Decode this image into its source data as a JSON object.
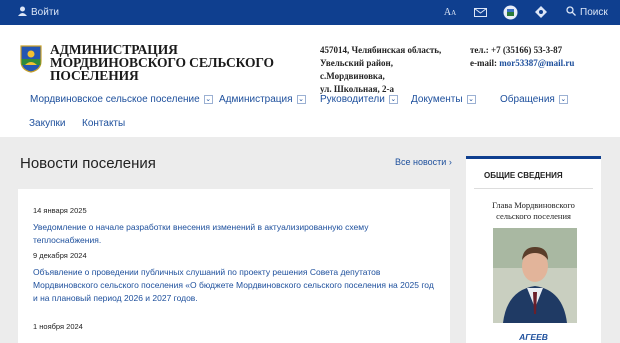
{
  "topbar": {
    "login_label": "Войти",
    "search_label": "Поиск",
    "icons": [
      "user-icon",
      "font-size-icon",
      "mail-icon",
      "emblem-icon",
      "accessibility-icon",
      "search-icon"
    ]
  },
  "header": {
    "org_title_lines": [
      "АДМИНИСТРАЦИЯ",
      "МОРДВИНОВСКОГО СЕЛЬСКОГО",
      "ПОСЕЛЕНИЯ"
    ],
    "address_lines": [
      "457014, Челябинская область,",
      "Увельский район,",
      "с.Мордвиновка,",
      "ул. Школьная, 2-а"
    ],
    "phone": "тел.: +7 (35166) 53-3-87",
    "email_label": "e-mail:",
    "email": "mor53387@mail.ru"
  },
  "nav": {
    "items": [
      {
        "label": "Мордвиновское сельское поселение",
        "has_dropdown": true
      },
      {
        "label": "Администрация",
        "has_dropdown": true
      },
      {
        "label": "Руководители",
        "has_dropdown": true
      },
      {
        "label": "Документы",
        "has_dropdown": true
      },
      {
        "label": "Обращения",
        "has_dropdown": true
      },
      {
        "label": "Закупки",
        "has_dropdown": false
      },
      {
        "label": "Контакты",
        "has_dropdown": false
      }
    ]
  },
  "news": {
    "title": "Новости поселения",
    "all_news": "Все новости",
    "items": [
      {
        "date": "14 января 2025",
        "text": "Уведомление о начале разработки внесения изменений в актуализированную схему теплоснабжения."
      },
      {
        "date": "9 декабря 2024",
        "text": "Объявление о проведении публичных слушаний по проекту решения Совета депутатов Мордвиновского сельского поселения «О бюджете Мордвиновского сельского поселения на 2025 год и на плановый период 2026 и 2027 годов."
      },
      {
        "date": "1 ноября 2024",
        "text": ""
      }
    ]
  },
  "sidebar": {
    "heading": "ОБЩИЕ СВЕДЕНИЯ",
    "role": "Глава Мордвиновского сельского поселения",
    "name": "АГЕЕВ"
  },
  "colors": {
    "topbar": "#0f3f8f",
    "link": "#1d4f9c",
    "content_bg": "#ececec"
  }
}
